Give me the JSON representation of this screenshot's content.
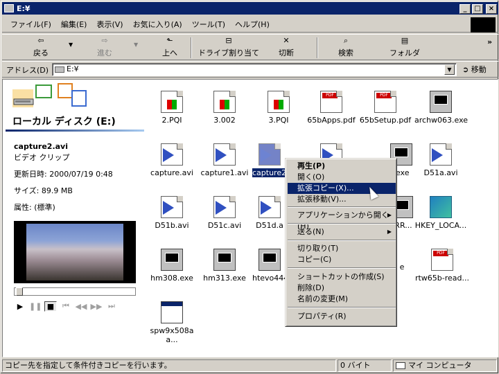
{
  "window": {
    "title": "E:¥"
  },
  "menu": [
    "ファイル(F)",
    "編集(E)",
    "表示(V)",
    "お気に入り(A)",
    "ツール(T)",
    "ヘルプ(H)"
  ],
  "toolbar": {
    "back": "戻る",
    "forward": "進む",
    "up": "上へ",
    "map_drive": "ドライブ割り当て",
    "disconnect": "切断",
    "search": "検索",
    "folders": "フォルダ",
    "more": "»"
  },
  "address": {
    "label": "アドレス(D)",
    "value": "E:¥",
    "go": "移動"
  },
  "left_pane": {
    "drive_title": "ローカル ディスク (E:)",
    "file_name": "capture2.avi",
    "file_type": "ビデオ クリップ",
    "modified": "更新日時: 2000/07/19 0:48",
    "size": "サイズ: 89.9 MB",
    "attributes": "属性: (標準)"
  },
  "files": [
    {
      "name": "2.PQI",
      "icon": "pqi-icon"
    },
    {
      "name": "3.002",
      "icon": "pqi-icon"
    },
    {
      "name": "3.PQI",
      "icon": "pqi-icon"
    },
    {
      "name": "65bApps.pdf",
      "icon": "pdf-icon"
    },
    {
      "name": "65bSetup.pdf",
      "icon": "pdf-icon"
    },
    {
      "name": "archw063.exe",
      "icon": "exe-icon"
    },
    {
      "name": "capture.avi",
      "icon": "avi-icon"
    },
    {
      "name": "capture1.avi",
      "icon": "avi-icon"
    },
    {
      "name": "capture2.avi",
      "icon": "avi-icon"
    },
    {
      "name": "",
      "icon": "avi-icon"
    },
    {
      "name": ".exe",
      "icon": "exe-icon"
    },
    {
      "name": "D51a.avi",
      "icon": "avi-icon"
    },
    {
      "name": "D51b.avi",
      "icon": "avi-icon"
    },
    {
      "name": "D51c.avi",
      "icon": "avi-icon"
    },
    {
      "name": "D51d.a",
      "icon": "avi-icon"
    },
    {
      "name": "RR...",
      "icon": "exe-icon"
    },
    {
      "name": "HKEY_LOCA...",
      "icon": "reg-icon"
    },
    {
      "name": "hm308.exe",
      "icon": "exe-icon"
    },
    {
      "name": "hm313.exe",
      "icon": "exe-icon"
    },
    {
      "name": "htevo444",
      "icon": "exe-icon"
    },
    {
      "name": "e",
      "icon": "exe-icon"
    },
    {
      "name": "rtw65b-read...",
      "icon": "pdf-icon"
    },
    {
      "name": "spw9x508a a...",
      "icon": "window-icon"
    }
  ],
  "context_menu": [
    {
      "label": "再生(P)"
    },
    {
      "label": "開く(O)"
    },
    {
      "label": "拡張コピー(X)..."
    },
    {
      "label": "拡張移動(V)..."
    },
    {
      "label": "アプリケーションから開く(H)"
    },
    {
      "label": "送る(N)"
    },
    {
      "label": "切り取り(T)"
    },
    {
      "label": "コピー(C)"
    },
    {
      "label": "ショートカットの作成(S)"
    },
    {
      "label": "削除(D)"
    },
    {
      "label": "名前の変更(M)"
    },
    {
      "label": "プロパティ(R)"
    }
  ],
  "status": {
    "message": "コピー先を指定して条件付きコピーを行います。",
    "size": "0 バイト",
    "location": "マイ コンピュータ"
  }
}
